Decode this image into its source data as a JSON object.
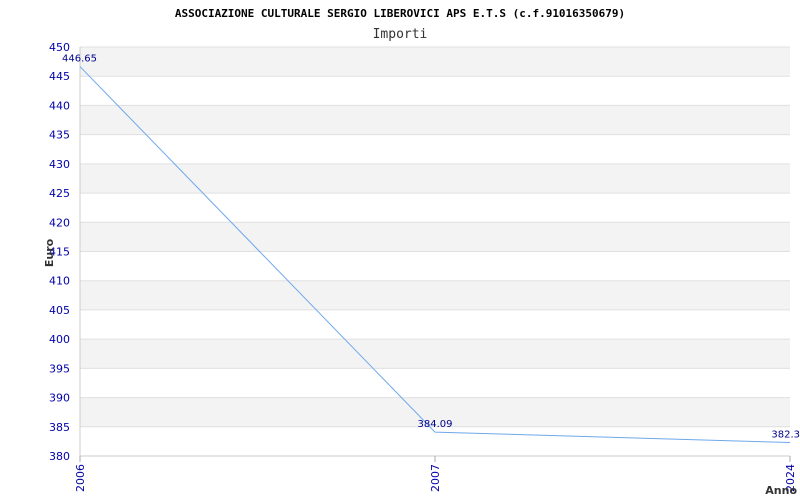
{
  "chart_data": {
    "type": "line",
    "title": "ASSOCIAZIONE CULTURALE SERGIO LIBEROVICI APS E.T.S (c.f.91016350679)",
    "subtitle": "Importi",
    "xlabel": "Anno",
    "ylabel": "Euro",
    "categories": [
      "2006",
      "2007",
      "2024"
    ],
    "series": [
      {
        "values": [
          446.65,
          384.09,
          382.3
        ],
        "labels": [
          "446.65",
          "384.09",
          "382.3"
        ]
      }
    ],
    "ylim": [
      380,
      450
    ],
    "yticks": [
      380,
      385,
      390,
      395,
      400,
      405,
      410,
      415,
      420,
      425,
      430,
      435,
      440,
      445,
      450
    ],
    "grid": true,
    "colors": {
      "line": "#6fa8ec",
      "band": "#f3f3f3",
      "gridline": "#e0e0e0",
      "tick": "#0000aa",
      "label": "#00008b"
    }
  }
}
